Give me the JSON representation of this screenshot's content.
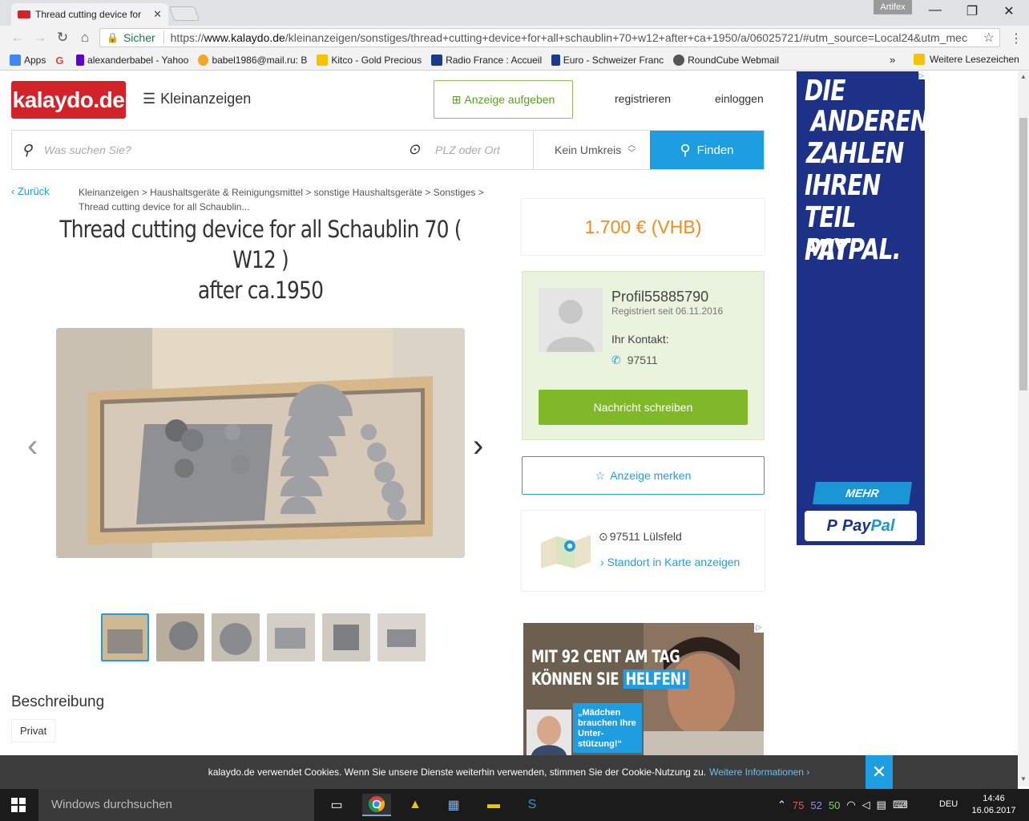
{
  "browser": {
    "tab_title": "Thread cutting device for",
    "profile_badge": "Artifex",
    "secure_label": "Sicher",
    "url_scheme": "https://",
    "url_host": "www.kalaydo.de",
    "url_path": "/kleinanzeigen/sonstiges/thread+cutting+device+for+all+schaublin+70+w12+after+ca+1950/a/06025721/#utm_source=Local24&utm_mec",
    "bookmarks": [
      {
        "label": "Apps",
        "color": "#4285f4"
      },
      {
        "label": "",
        "color": "#ea4335"
      },
      {
        "label": "alexanderbabel - Yahoo",
        "color": "#5f01d1"
      },
      {
        "label": "babel1986@mail.ru: B",
        "color": "#f5a623"
      },
      {
        "label": "Kitco - Gold Precious",
        "color": "#f5c400"
      },
      {
        "label": "Radio France : Accueil",
        "color": "#1b3a8c"
      },
      {
        "label": "Euro - Schweizer Franc",
        "color": "#1b3a8c"
      },
      {
        "label": "RoundCube Webmail",
        "color": "#555555"
      }
    ],
    "bookmarks_more": "»",
    "bookmarks_other": "Weitere Lesezeichen"
  },
  "header": {
    "logo": "kalaydo.de",
    "menu_label": "Kleinanzeigen",
    "post_ad": "Anzeige aufgeben",
    "register": "registrieren",
    "login": "einloggen"
  },
  "search": {
    "what_placeholder": "Was suchen Sie?",
    "where_placeholder": "PLZ oder Ort",
    "radius": "Kein Umkreis",
    "button": "Finden"
  },
  "breadcrumb": {
    "back": "Zurück",
    "items": [
      "Kleinanzeigen",
      "Haushaltsgeräte & Reinigungsmittel",
      "sonstige Haushaltsgeräte",
      "Sonstiges",
      "Thread cutting device for all Schaublin..."
    ]
  },
  "listing": {
    "title_line1": "Thread cutting device for all Schaublin 70 ( W12 )",
    "title_line2": "after ca.1950",
    "price": "1.700 € (VHB)",
    "description_heading": "Beschreibung",
    "seller_type": "Privat",
    "thumbnail_count": 6
  },
  "seller": {
    "name": "Profil55885790",
    "since": "Registriert seit 06.11.2016",
    "contact_label": "Ihr Kontakt:",
    "phone": "97511",
    "message_button": "Nachricht schreiben",
    "save_button": "Anzeige merken",
    "location": "97511 Lülsfeld",
    "map_link": "Standort in Karte anzeigen"
  },
  "ad_right": {
    "lines": [
      "DIE",
      "ANDEREN",
      "ZAHLEN",
      "IHREN",
      "TEIL MIT",
      "PAYPAL."
    ],
    "cta": "MEHR ERFAHREN",
    "brand_a": "Pay",
    "brand_b": "Pal",
    "brand_mark": "P",
    "close": "▷"
  },
  "ad_bottom": {
    "line1": "MIT 92 CENT AM TAG",
    "line2": "KÖNNEN SIE",
    "highlight": "HELFEN!",
    "quote": "„Mädchen brauchen Ihre Unter-stützung!“"
  },
  "cookie": {
    "text": "kalaydo.de verwendet Cookies. Wenn Sie unsere Dienste weiterhin verwenden, stimmen Sie der Cookie-Nutzung zu.",
    "link": "Weitere Informationen",
    "close": "✕"
  },
  "taskbar": {
    "search_placeholder": "Windows durchsuchen",
    "tray_numbers": [
      "75",
      "52",
      "50"
    ],
    "language": "DEU",
    "time": "14:46",
    "date": "16.06.2017"
  }
}
